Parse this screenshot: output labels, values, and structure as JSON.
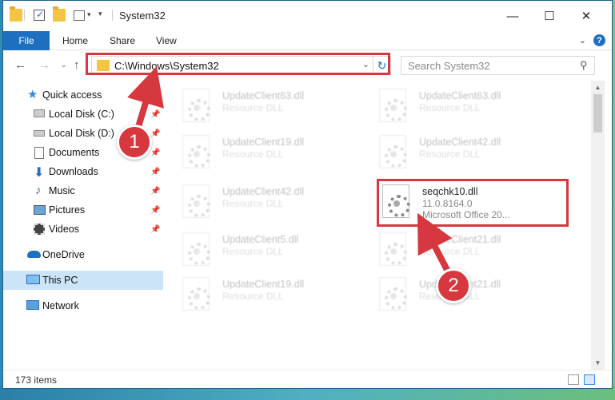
{
  "window": {
    "title": "System32",
    "controls": {
      "minimize": "—",
      "maximize": "☐",
      "close": "✕"
    }
  },
  "ribbon": {
    "tabs": [
      "File",
      "Home",
      "Share",
      "View"
    ],
    "expand": "⌄",
    "help": "?"
  },
  "address": {
    "path": "C:\\Windows\\System32",
    "search_placeholder": "Search System32"
  },
  "sidebar": {
    "items": [
      {
        "label": "Quick access",
        "icon": "star-icon",
        "pinned": false
      },
      {
        "label": "Local Disk (C:)",
        "icon": "drive-icon",
        "pinned": true
      },
      {
        "label": "Local Disk (D:)",
        "icon": "drive-icon",
        "pinned": true
      },
      {
        "label": "Documents",
        "icon": "documents-icon",
        "pinned": true
      },
      {
        "label": "Downloads",
        "icon": "download-icon",
        "pinned": true
      },
      {
        "label": "Music",
        "icon": "music-icon",
        "pinned": true
      },
      {
        "label": "Pictures",
        "icon": "pictures-icon",
        "pinned": true
      },
      {
        "label": "Videos",
        "icon": "videos-icon",
        "pinned": true
      },
      {
        "label": "OneDrive",
        "icon": "cloud-icon",
        "pinned": false
      },
      {
        "label": "This PC",
        "icon": "pc-icon",
        "pinned": false,
        "selected": true
      },
      {
        "label": "Network",
        "icon": "network-icon",
        "pinned": false
      }
    ]
  },
  "files": [
    {
      "name": "UpdateClient63.dll",
      "type": "Resource DLL",
      "faded": true
    },
    {
      "name": "UpdateClient63.dll",
      "type": "Resource DLL",
      "faded": true
    },
    {
      "name": "UpdateClient19.dll",
      "type": "Resource DLL",
      "faded": true
    },
    {
      "name": "UpdateClient42.dll",
      "type": "Resource DLL",
      "faded": true
    },
    {
      "name": "UpdateClient42.dll",
      "type": "Resource DLL",
      "faded": true
    },
    {
      "name": "seqchk10.dll",
      "version": "11.0.8164.0",
      "type": "Microsoft Office 20...",
      "faded": false
    },
    {
      "name": "UpdateClient5.dll",
      "type": "Resource DLL",
      "faded": true
    },
    {
      "name": "UpdateClient21.dll",
      "type": "Resource DLL",
      "faded": true
    },
    {
      "name": "UpdateClient19.dll",
      "type": "Resource DLL",
      "faded": true
    },
    {
      "name": "UpdateClient21.dll",
      "type": "Resource DLL",
      "faded": true
    }
  ],
  "status": {
    "item_count": "173 items"
  },
  "annotations": {
    "step1": "1",
    "step2": "2",
    "color": "#d7373f"
  }
}
